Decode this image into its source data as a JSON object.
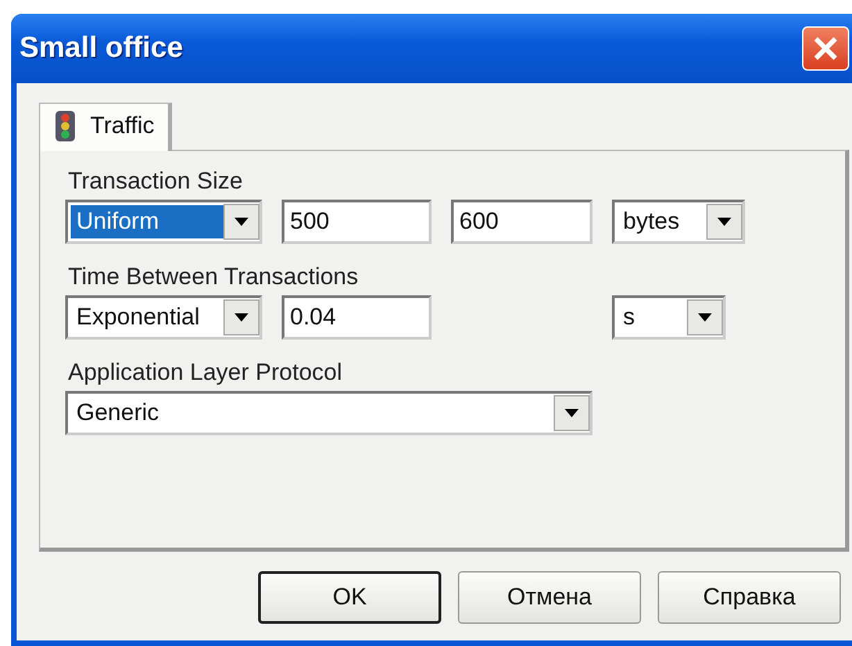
{
  "window": {
    "title": "Small office"
  },
  "tabs": [
    {
      "label": "Traffic",
      "selected": true
    }
  ],
  "sections": [
    {
      "label": "Transaction Size",
      "controls": [
        {
          "kind": "distribution",
          "value": "Uniform",
          "focused": true
        },
        {
          "kind": "number",
          "value": "500"
        },
        {
          "kind": "number",
          "value": "600"
        },
        {
          "kind": "unit",
          "value": "bytes",
          "focused": false
        }
      ]
    },
    {
      "label": "Time Between Transactions",
      "controls": [
        {
          "kind": "distribution",
          "value": "Exponential",
          "focused": false
        },
        {
          "kind": "number",
          "value": "0.04"
        },
        {
          "kind": "unit",
          "value": "s",
          "focused": false
        }
      ]
    },
    {
      "label": "Application Layer Protocol",
      "controls": [
        {
          "kind": "protocol",
          "value": "Generic",
          "focused": false
        }
      ]
    }
  ],
  "buttons": [
    {
      "label": "OK",
      "default": true
    },
    {
      "label": "Отмена",
      "default": false
    },
    {
      "label": "Справка",
      "default": false
    }
  ]
}
